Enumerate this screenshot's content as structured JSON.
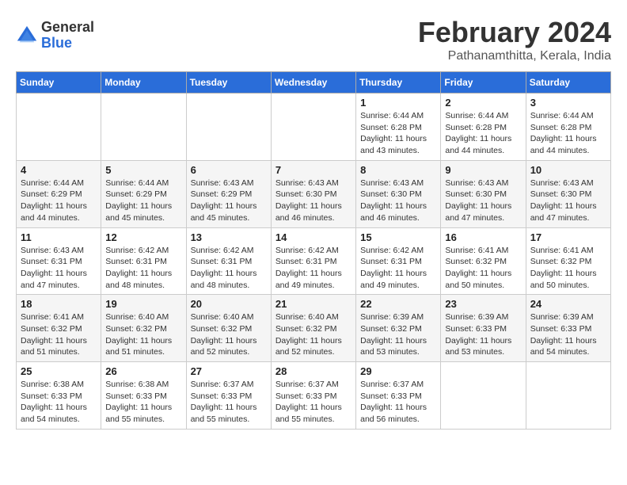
{
  "logo": {
    "general": "General",
    "blue": "Blue"
  },
  "title": "February 2024",
  "location": "Pathanamthitta, Kerala, India",
  "weekdays": [
    "Sunday",
    "Monday",
    "Tuesday",
    "Wednesday",
    "Thursday",
    "Friday",
    "Saturday"
  ],
  "weeks": [
    [
      {
        "day": "",
        "sunrise": "",
        "sunset": "",
        "daylight": ""
      },
      {
        "day": "",
        "sunrise": "",
        "sunset": "",
        "daylight": ""
      },
      {
        "day": "",
        "sunrise": "",
        "sunset": "",
        "daylight": ""
      },
      {
        "day": "",
        "sunrise": "",
        "sunset": "",
        "daylight": ""
      },
      {
        "day": "1",
        "sunrise": "Sunrise: 6:44 AM",
        "sunset": "Sunset: 6:28 PM",
        "daylight": "Daylight: 11 hours and 43 minutes."
      },
      {
        "day": "2",
        "sunrise": "Sunrise: 6:44 AM",
        "sunset": "Sunset: 6:28 PM",
        "daylight": "Daylight: 11 hours and 44 minutes."
      },
      {
        "day": "3",
        "sunrise": "Sunrise: 6:44 AM",
        "sunset": "Sunset: 6:28 PM",
        "daylight": "Daylight: 11 hours and 44 minutes."
      }
    ],
    [
      {
        "day": "4",
        "sunrise": "Sunrise: 6:44 AM",
        "sunset": "Sunset: 6:29 PM",
        "daylight": "Daylight: 11 hours and 44 minutes."
      },
      {
        "day": "5",
        "sunrise": "Sunrise: 6:44 AM",
        "sunset": "Sunset: 6:29 PM",
        "daylight": "Daylight: 11 hours and 45 minutes."
      },
      {
        "day": "6",
        "sunrise": "Sunrise: 6:43 AM",
        "sunset": "Sunset: 6:29 PM",
        "daylight": "Daylight: 11 hours and 45 minutes."
      },
      {
        "day": "7",
        "sunrise": "Sunrise: 6:43 AM",
        "sunset": "Sunset: 6:30 PM",
        "daylight": "Daylight: 11 hours and 46 minutes."
      },
      {
        "day": "8",
        "sunrise": "Sunrise: 6:43 AM",
        "sunset": "Sunset: 6:30 PM",
        "daylight": "Daylight: 11 hours and 46 minutes."
      },
      {
        "day": "9",
        "sunrise": "Sunrise: 6:43 AM",
        "sunset": "Sunset: 6:30 PM",
        "daylight": "Daylight: 11 hours and 47 minutes."
      },
      {
        "day": "10",
        "sunrise": "Sunrise: 6:43 AM",
        "sunset": "Sunset: 6:30 PM",
        "daylight": "Daylight: 11 hours and 47 minutes."
      }
    ],
    [
      {
        "day": "11",
        "sunrise": "Sunrise: 6:43 AM",
        "sunset": "Sunset: 6:31 PM",
        "daylight": "Daylight: 11 hours and 47 minutes."
      },
      {
        "day": "12",
        "sunrise": "Sunrise: 6:42 AM",
        "sunset": "Sunset: 6:31 PM",
        "daylight": "Daylight: 11 hours and 48 minutes."
      },
      {
        "day": "13",
        "sunrise": "Sunrise: 6:42 AM",
        "sunset": "Sunset: 6:31 PM",
        "daylight": "Daylight: 11 hours and 48 minutes."
      },
      {
        "day": "14",
        "sunrise": "Sunrise: 6:42 AM",
        "sunset": "Sunset: 6:31 PM",
        "daylight": "Daylight: 11 hours and 49 minutes."
      },
      {
        "day": "15",
        "sunrise": "Sunrise: 6:42 AM",
        "sunset": "Sunset: 6:31 PM",
        "daylight": "Daylight: 11 hours and 49 minutes."
      },
      {
        "day": "16",
        "sunrise": "Sunrise: 6:41 AM",
        "sunset": "Sunset: 6:32 PM",
        "daylight": "Daylight: 11 hours and 50 minutes."
      },
      {
        "day": "17",
        "sunrise": "Sunrise: 6:41 AM",
        "sunset": "Sunset: 6:32 PM",
        "daylight": "Daylight: 11 hours and 50 minutes."
      }
    ],
    [
      {
        "day": "18",
        "sunrise": "Sunrise: 6:41 AM",
        "sunset": "Sunset: 6:32 PM",
        "daylight": "Daylight: 11 hours and 51 minutes."
      },
      {
        "day": "19",
        "sunrise": "Sunrise: 6:40 AM",
        "sunset": "Sunset: 6:32 PM",
        "daylight": "Daylight: 11 hours and 51 minutes."
      },
      {
        "day": "20",
        "sunrise": "Sunrise: 6:40 AM",
        "sunset": "Sunset: 6:32 PM",
        "daylight": "Daylight: 11 hours and 52 minutes."
      },
      {
        "day": "21",
        "sunrise": "Sunrise: 6:40 AM",
        "sunset": "Sunset: 6:32 PM",
        "daylight": "Daylight: 11 hours and 52 minutes."
      },
      {
        "day": "22",
        "sunrise": "Sunrise: 6:39 AM",
        "sunset": "Sunset: 6:32 PM",
        "daylight": "Daylight: 11 hours and 53 minutes."
      },
      {
        "day": "23",
        "sunrise": "Sunrise: 6:39 AM",
        "sunset": "Sunset: 6:33 PM",
        "daylight": "Daylight: 11 hours and 53 minutes."
      },
      {
        "day": "24",
        "sunrise": "Sunrise: 6:39 AM",
        "sunset": "Sunset: 6:33 PM",
        "daylight": "Daylight: 11 hours and 54 minutes."
      }
    ],
    [
      {
        "day": "25",
        "sunrise": "Sunrise: 6:38 AM",
        "sunset": "Sunset: 6:33 PM",
        "daylight": "Daylight: 11 hours and 54 minutes."
      },
      {
        "day": "26",
        "sunrise": "Sunrise: 6:38 AM",
        "sunset": "Sunset: 6:33 PM",
        "daylight": "Daylight: 11 hours and 55 minutes."
      },
      {
        "day": "27",
        "sunrise": "Sunrise: 6:37 AM",
        "sunset": "Sunset: 6:33 PM",
        "daylight": "Daylight: 11 hours and 55 minutes."
      },
      {
        "day": "28",
        "sunrise": "Sunrise: 6:37 AM",
        "sunset": "Sunset: 6:33 PM",
        "daylight": "Daylight: 11 hours and 55 minutes."
      },
      {
        "day": "29",
        "sunrise": "Sunrise: 6:37 AM",
        "sunset": "Sunset: 6:33 PM",
        "daylight": "Daylight: 11 hours and 56 minutes."
      },
      {
        "day": "",
        "sunrise": "",
        "sunset": "",
        "daylight": ""
      },
      {
        "day": "",
        "sunrise": "",
        "sunset": "",
        "daylight": ""
      }
    ]
  ]
}
